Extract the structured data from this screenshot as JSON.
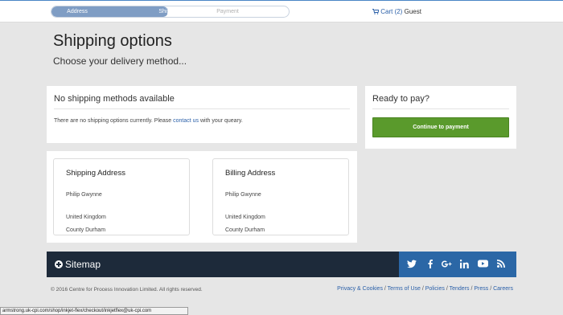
{
  "progress": {
    "steps": [
      "Address",
      "Shipping",
      "Payment"
    ],
    "completed_fraction": 0.49
  },
  "cart": {
    "label": "Cart (2)",
    "user": "Guest"
  },
  "page": {
    "title": "Shipping options",
    "subtitle": "Choose your delivery method..."
  },
  "shipping_methods": {
    "heading": "No shipping methods available",
    "message_before": "There are no shipping options currently. Please ",
    "contact_link": "contact us",
    "message_after": " with your queary."
  },
  "payment": {
    "heading": "Ready to pay?",
    "button_label": "Continue to payment"
  },
  "addresses": {
    "shipping": {
      "heading": "Shipping Address",
      "lines": [
        "Philip Gwynne",
        "United Kingdom",
        "County Durham"
      ]
    },
    "billing": {
      "heading": "Billing Address",
      "lines": [
        "Philip Gwynne",
        "United Kingdom",
        "County Durham"
      ]
    }
  },
  "footer": {
    "sitemap_label": "Sitemap",
    "social_icons": [
      "twitter-icon",
      "facebook-icon",
      "google-plus-icon",
      "linkedin-icon",
      "youtube-icon",
      "rss-icon"
    ],
    "copyright": "© 2016 Centre for Process Innovation Limited. All rights reserved.",
    "links": [
      "Privacy & Cookies",
      "Terms of Use",
      "Policies",
      "Tenders",
      "Press",
      "Careers"
    ],
    "separator": " / "
  },
  "status_url": "armstrong.uk-cpi.com/shop/inkjet-flex/checkout/inkjetflex@uk-cpi.com",
  "colors": {
    "accent_blue": "#2a5fa8",
    "progress_fill": "#7f9dc4",
    "pay_button": "#5a9a2c",
    "sitemap_bg": "#1d2a3a",
    "social_bg": "#2b67a6"
  }
}
